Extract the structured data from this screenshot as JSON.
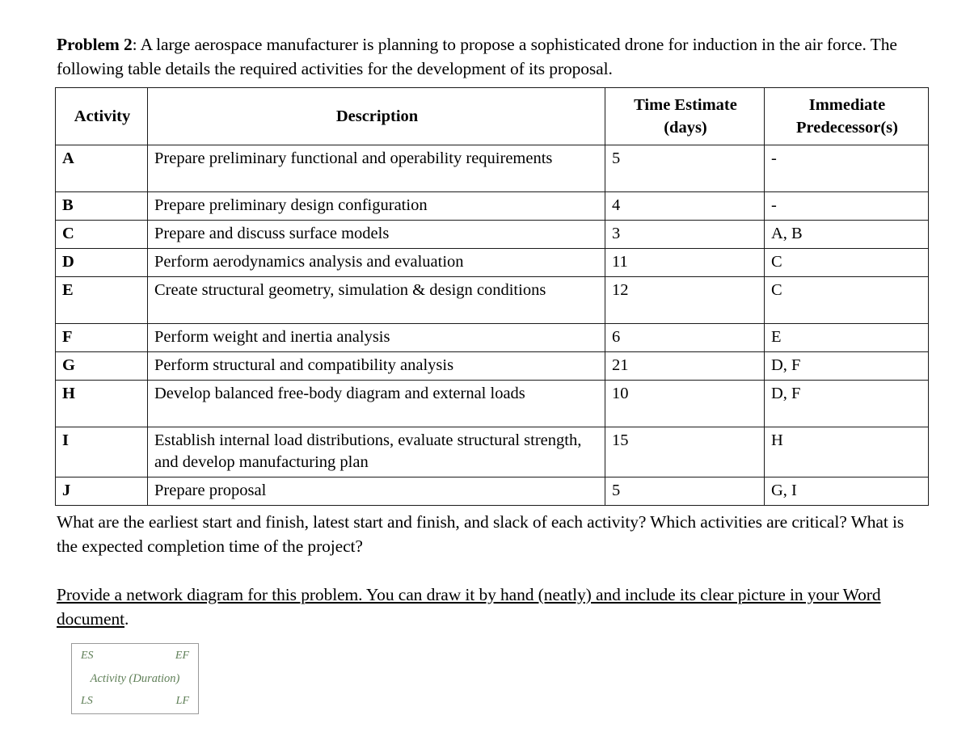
{
  "document": {
    "intro": {
      "lead": "Problem 2",
      "body": ": A large aerospace manufacturer is planning to propose a sophisticated drone for induction in the air force. The following table details the required activities for the development of its proposal."
    },
    "table": {
      "headers": {
        "activity": "Activity",
        "description": "Description",
        "time_estimate_line1": "Time Estimate",
        "time_estimate_line2": "(days)",
        "predecessor_line1": "Immediate",
        "predecessor_line2": "Predecessor(s)"
      },
      "rows": [
        {
          "activity": "A",
          "description": "Prepare preliminary functional and operability requirements",
          "time": "5",
          "predecessors": "-"
        },
        {
          "activity": "B",
          "description": "Prepare preliminary design configuration",
          "time": "4",
          "predecessors": "-"
        },
        {
          "activity": "C",
          "description": "Prepare and discuss surface models",
          "time": "3",
          "predecessors": "A, B"
        },
        {
          "activity": "D",
          "description": "Perform aerodynamics analysis and evaluation",
          "time": "11",
          "predecessors": "C"
        },
        {
          "activity": "E",
          "description": "Create structural geometry, simulation & design conditions",
          "time": "12",
          "predecessors": "C"
        },
        {
          "activity": "F",
          "description": "Perform weight and inertia analysis",
          "time": "6",
          "predecessors": "E"
        },
        {
          "activity": "G",
          "description": "Perform structural and compatibility analysis",
          "time": "21",
          "predecessors": "D, F"
        },
        {
          "activity": "H",
          "description": "Develop balanced free-body diagram and external loads",
          "time": "10",
          "predecessors": "D, F"
        },
        {
          "activity": "I",
          "description": "Establish internal load distributions, evaluate structural strength, and develop manufacturing plan",
          "time": "15",
          "predecessors": "H"
        },
        {
          "activity": "J",
          "description": "Prepare proposal",
          "time": "5",
          "predecessors": "G, I"
        }
      ]
    },
    "questions": "What are the earliest start and finish, latest start and finish, and slack of each activity? Which activities are critical? What is the expected completion time of the project?",
    "instruction": "Provide a network diagram for this problem. You can draw it by hand (neatly) and include its clear picture in your Word document",
    "instruction_tail": ".",
    "legend": {
      "es": "ES",
      "ef": "EF",
      "middle": "Activity (Duration)",
      "ls": "LS",
      "lf": "LF",
      "text_color": "#5f7f57",
      "border_color": "#9a9a9a"
    }
  }
}
